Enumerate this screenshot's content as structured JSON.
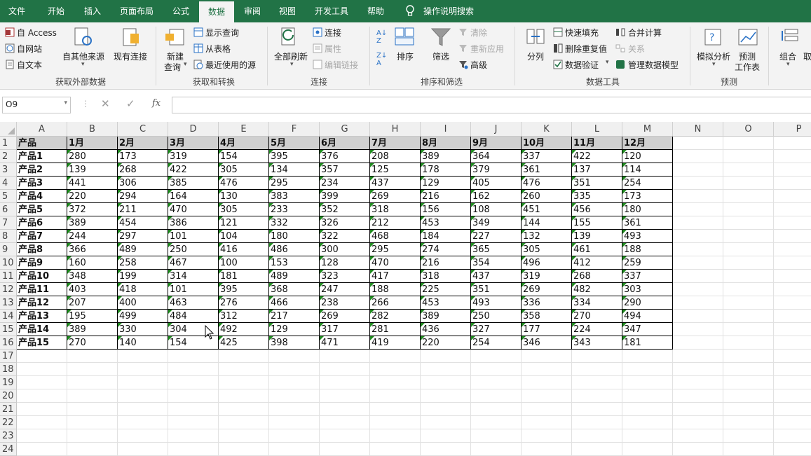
{
  "tabs": [
    "文件",
    "开始",
    "插入",
    "页面布局",
    "公式",
    "数据",
    "审阅",
    "视图",
    "开发工具",
    "帮助"
  ],
  "active_tab": "数据",
  "tell_me": "操作说明搜索",
  "ribbon": {
    "get_external": {
      "access": "自 Access",
      "web": "自网站",
      "text": "自文本",
      "other_sources": "自其他来源",
      "existing": "现有连接",
      "label": "获取外部数据"
    },
    "get_transform": {
      "new_query_1": "新建",
      "new_query_2": "查询",
      "show_queries": "显示查询",
      "from_table": "从表格",
      "recent_sources": "最近使用的源",
      "label": "获取和转换"
    },
    "connections": {
      "refresh_all": "全部刷新",
      "connections": "连接",
      "properties": "属性",
      "edit_links": "编辑链接",
      "label": "连接"
    },
    "sort_filter": {
      "sort": "排序",
      "filter": "筛选",
      "clear": "清除",
      "reapply": "重新应用",
      "advanced": "高级",
      "label": "排序和筛选"
    },
    "data_tools": {
      "text_to_columns": "分列",
      "flash_fill": "快速填充",
      "remove_duplicates": "删除重复值",
      "data_validation": "数据验证",
      "consolidate": "合并计算",
      "relationships": "关系",
      "manage_model": "管理数据模型",
      "label": "数据工具"
    },
    "forecast": {
      "what_if": "模拟分析",
      "forecast_sheet_1": "预测",
      "forecast_sheet_2": "工作表",
      "label": "预测"
    },
    "outline": {
      "group": "组合",
      "ungroup": "取"
    }
  },
  "formula_bar": {
    "name_box": "O9",
    "fx": "fx",
    "formula": ""
  },
  "columns": [
    "A",
    "B",
    "C",
    "D",
    "E",
    "F",
    "G",
    "H",
    "I",
    "J",
    "K",
    "L",
    "M",
    "N",
    "O",
    "P"
  ],
  "rows": [
    "1",
    "2",
    "3",
    "4",
    "5",
    "6",
    "7",
    "8",
    "9",
    "10",
    "11",
    "12",
    "13",
    "14",
    "15",
    "16",
    "17",
    "18",
    "19",
    "20",
    "21",
    "22",
    "23",
    "24"
  ],
  "table": {
    "header": [
      "产品",
      "1月",
      "2月",
      "3月",
      "4月",
      "5月",
      "6月",
      "7月",
      "8月",
      "9月",
      "10月",
      "11月",
      "12月"
    ],
    "rows": [
      [
        "产品1",
        "280",
        "173",
        "319",
        "154",
        "395",
        "376",
        "208",
        "389",
        "364",
        "337",
        "422",
        "120"
      ],
      [
        "产品2",
        "139",
        "268",
        "422",
        "305",
        "134",
        "357",
        "125",
        "178",
        "379",
        "361",
        "137",
        "114"
      ],
      [
        "产品3",
        "441",
        "306",
        "385",
        "476",
        "295",
        "234",
        "437",
        "129",
        "405",
        "476",
        "351",
        "254"
      ],
      [
        "产品4",
        "220",
        "294",
        "164",
        "130",
        "383",
        "399",
        "269",
        "216",
        "162",
        "260",
        "335",
        "173"
      ],
      [
        "产品5",
        "372",
        "211",
        "470",
        "305",
        "233",
        "352",
        "318",
        "156",
        "108",
        "451",
        "456",
        "180"
      ],
      [
        "产品6",
        "389",
        "454",
        "386",
        "121",
        "332",
        "326",
        "212",
        "453",
        "349",
        "144",
        "155",
        "361"
      ],
      [
        "产品7",
        "244",
        "297",
        "101",
        "104",
        "180",
        "322",
        "468",
        "184",
        "227",
        "132",
        "139",
        "493"
      ],
      [
        "产品8",
        "366",
        "489",
        "250",
        "416",
        "486",
        "300",
        "295",
        "274",
        "365",
        "305",
        "461",
        "188"
      ],
      [
        "产品9",
        "160",
        "258",
        "467",
        "100",
        "153",
        "128",
        "470",
        "216",
        "354",
        "496",
        "412",
        "259"
      ],
      [
        "产品10",
        "348",
        "199",
        "314",
        "181",
        "489",
        "323",
        "417",
        "318",
        "437",
        "319",
        "268",
        "337"
      ],
      [
        "产品11",
        "403",
        "418",
        "101",
        "395",
        "368",
        "247",
        "188",
        "225",
        "351",
        "269",
        "482",
        "303"
      ],
      [
        "产品12",
        "207",
        "400",
        "463",
        "276",
        "466",
        "238",
        "266",
        "453",
        "493",
        "336",
        "334",
        "290"
      ],
      [
        "产品13",
        "195",
        "499",
        "484",
        "312",
        "217",
        "269",
        "282",
        "389",
        "250",
        "358",
        "270",
        "494"
      ],
      [
        "产品14",
        "389",
        "330",
        "304",
        "492",
        "129",
        "317",
        "281",
        "436",
        "327",
        "177",
        "224",
        "347"
      ],
      [
        "产品15",
        "270",
        "140",
        "154",
        "425",
        "398",
        "471",
        "419",
        "220",
        "254",
        "346",
        "343",
        "181"
      ]
    ]
  },
  "colors": {
    "accent": "#217346",
    "header_fill": "#d0d0d0",
    "error_triangle": "#1e8a1e"
  }
}
